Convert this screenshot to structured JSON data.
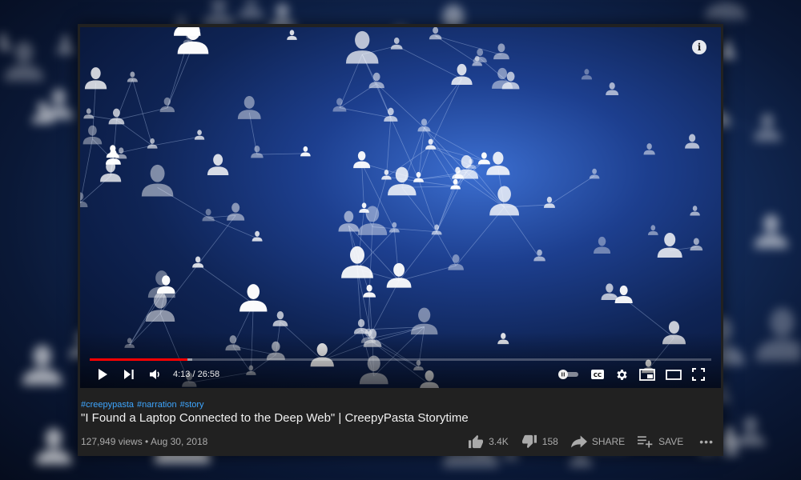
{
  "player": {
    "time_current": "4:13",
    "time_separator": " / ",
    "time_total": "26:58",
    "progress_fraction": 0.157,
    "buffered_fraction": 0.165
  },
  "video": {
    "hashtags": [
      "#creepypasta",
      "#narration",
      "#story"
    ],
    "title": "\"I Found a Laptop Connected to the Deep Web\" | CreepyPasta Storytime",
    "views": "127,949 views",
    "separator": " • ",
    "date": "Aug 30, 2018"
  },
  "actions": {
    "like_count": "3.4K",
    "dislike_count": "158",
    "share_label": "SHARE",
    "save_label": "SAVE",
    "more_label": "•••"
  },
  "icons": {
    "info": "info-icon",
    "play": "play-icon",
    "next": "next-icon",
    "volume": "volume-icon",
    "autoplay": "autoplay-toggle-icon",
    "captions": "captions-icon",
    "settings": "gear-icon",
    "miniplayer": "miniplayer-icon",
    "theater": "theater-mode-icon",
    "fullscreen": "fullscreen-icon",
    "like": "thumbs-up-icon",
    "dislike": "thumbs-down-icon",
    "share": "share-icon",
    "save": "add-to-playlist-icon",
    "more": "more-icon"
  },
  "colors": {
    "progress": "#ff0000",
    "hashtag": "#3ea6ff",
    "card_bg": "#212121"
  }
}
